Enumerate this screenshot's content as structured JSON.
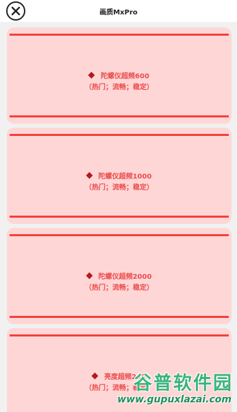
{
  "header": {
    "title": "画质MxPro",
    "close_icon": "close-icon"
  },
  "options": [
    {
      "label": "陀螺仪超频600",
      "tags": "（热门；流畅；稳定）"
    },
    {
      "label": "陀螺仪超频1000",
      "tags": "（热门；流畅；稳定）"
    },
    {
      "label": "陀螺仪超频2000",
      "tags": "（热门；流畅；稳定）"
    },
    {
      "label": "亮度超频200",
      "tags": "（热门；流畅；稳定）"
    }
  ],
  "watermark": {
    "name": "谷普软件园",
    "url": "www.gupuxlazai.com"
  },
  "colors": {
    "card_bg": "#ffd6d6",
    "card_line": "#f0413c",
    "text": "#ea4d4d",
    "diamond": "#b5191f"
  }
}
